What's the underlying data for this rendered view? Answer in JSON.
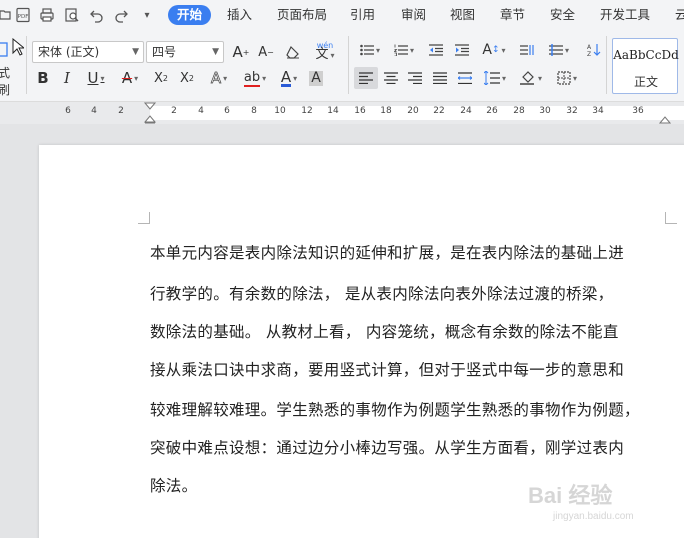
{
  "menu": {
    "tabs": [
      "开始",
      "插入",
      "页面布局",
      "引用",
      "审阅",
      "视图",
      "章节",
      "安全",
      "开发工具",
      "云"
    ],
    "active_tab": "开始"
  },
  "ribbon": {
    "font_name": "宋体 (正文)",
    "font_size": "四号",
    "format_brush_label": "式刷",
    "style_sample": "AaBbCcDd",
    "style_name": "正文",
    "phonetic_glyph": "wén",
    "colors": {
      "underline": "#333333",
      "font_color": "#e02020",
      "highlight": "#2a5bd7",
      "accent": "#3a7ef0"
    }
  },
  "ruler": {
    "numbers": [
      "6",
      "4",
      "2",
      "2",
      "4",
      "6",
      "8",
      "10",
      "12",
      "14",
      "16",
      "18",
      "20",
      "22",
      "24",
      "26",
      "28",
      "30",
      "32",
      "34",
      "36"
    ]
  },
  "document": {
    "lines": [
      "本单元内容是表内除法知识的延伸和扩展，是在表内除法的基础上进",
      "行教学的。有余数的除法，  是从表内除法向表外除法过渡的桥梁，",
      "数除法的基础。  从教材上看，  内容笼统，概念有余数的除法不能直",
      "接从乘法口诀中求商，要用竖式计算，但对于竖式中每一步的意思和",
      "较难理解较难理。学生熟悉的事物作为例题学生熟悉的事物作为例题，",
      "突破中难点设想：通过边分小棒边写强。从学生方面看，刚学过表内",
      "除法。"
    ]
  },
  "watermark": {
    "brand": "Bai 经验",
    "url": "jingyan.baidu.com"
  }
}
